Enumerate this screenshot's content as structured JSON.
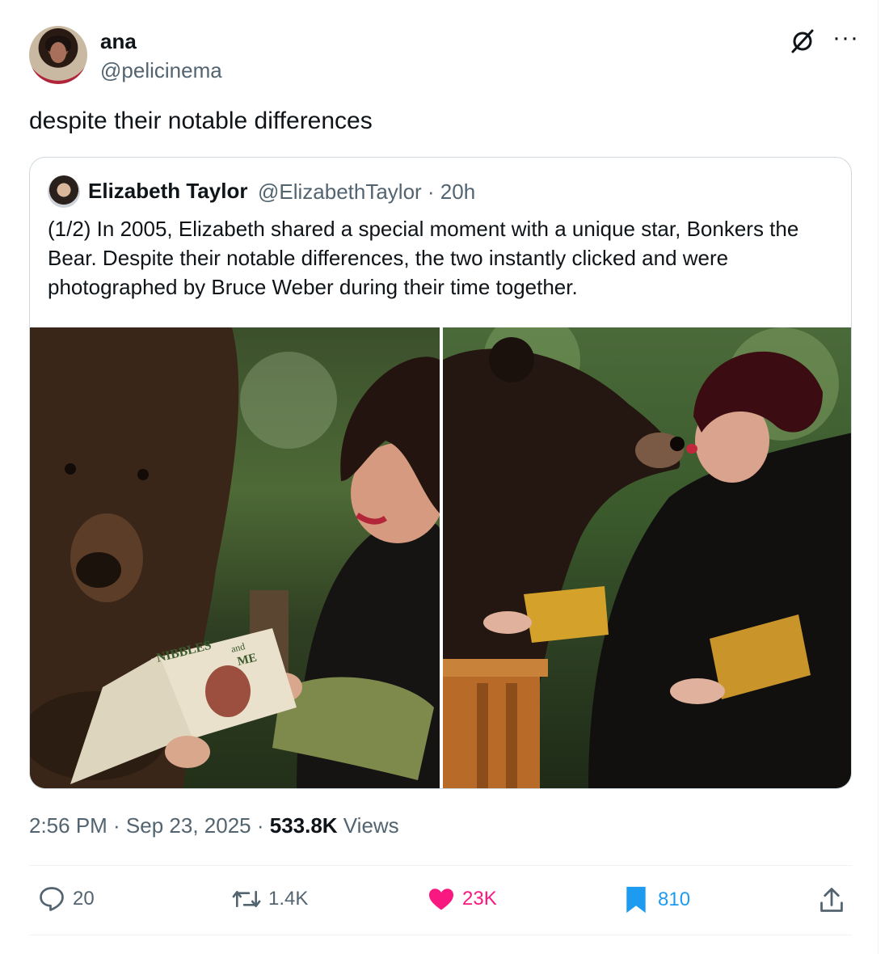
{
  "author": {
    "display_name": "ana",
    "handle": "@pelicinema",
    "avatar_icon": "user-avatar"
  },
  "tweet": {
    "text": "despite their notable differences",
    "timestamp": "2:56 PM · Sep 23, 2025 · ",
    "views_count": "533.8K",
    "views_label": " Views"
  },
  "quoted": {
    "display_name": "Elizabeth Taylor",
    "meta": "@ElizabethTaylor · 20h",
    "text": "(1/2) In 2005, Elizabeth shared a special moment with a unique star, Bonkers the Bear. Despite their notable differences, the two instantly clicked and were photographed by Bruce Weber during their time together.",
    "photos": [
      {
        "book_title": "NIBBLES",
        "book_and": "and",
        "book_me": "ME"
      },
      {}
    ]
  },
  "actions": {
    "replies": "20",
    "reposts": "1.4K",
    "likes": "23K",
    "bookmarks": "810"
  },
  "colors": {
    "like": "#f91880",
    "bookmark": "#1d9bf0",
    "muted": "#536471"
  }
}
